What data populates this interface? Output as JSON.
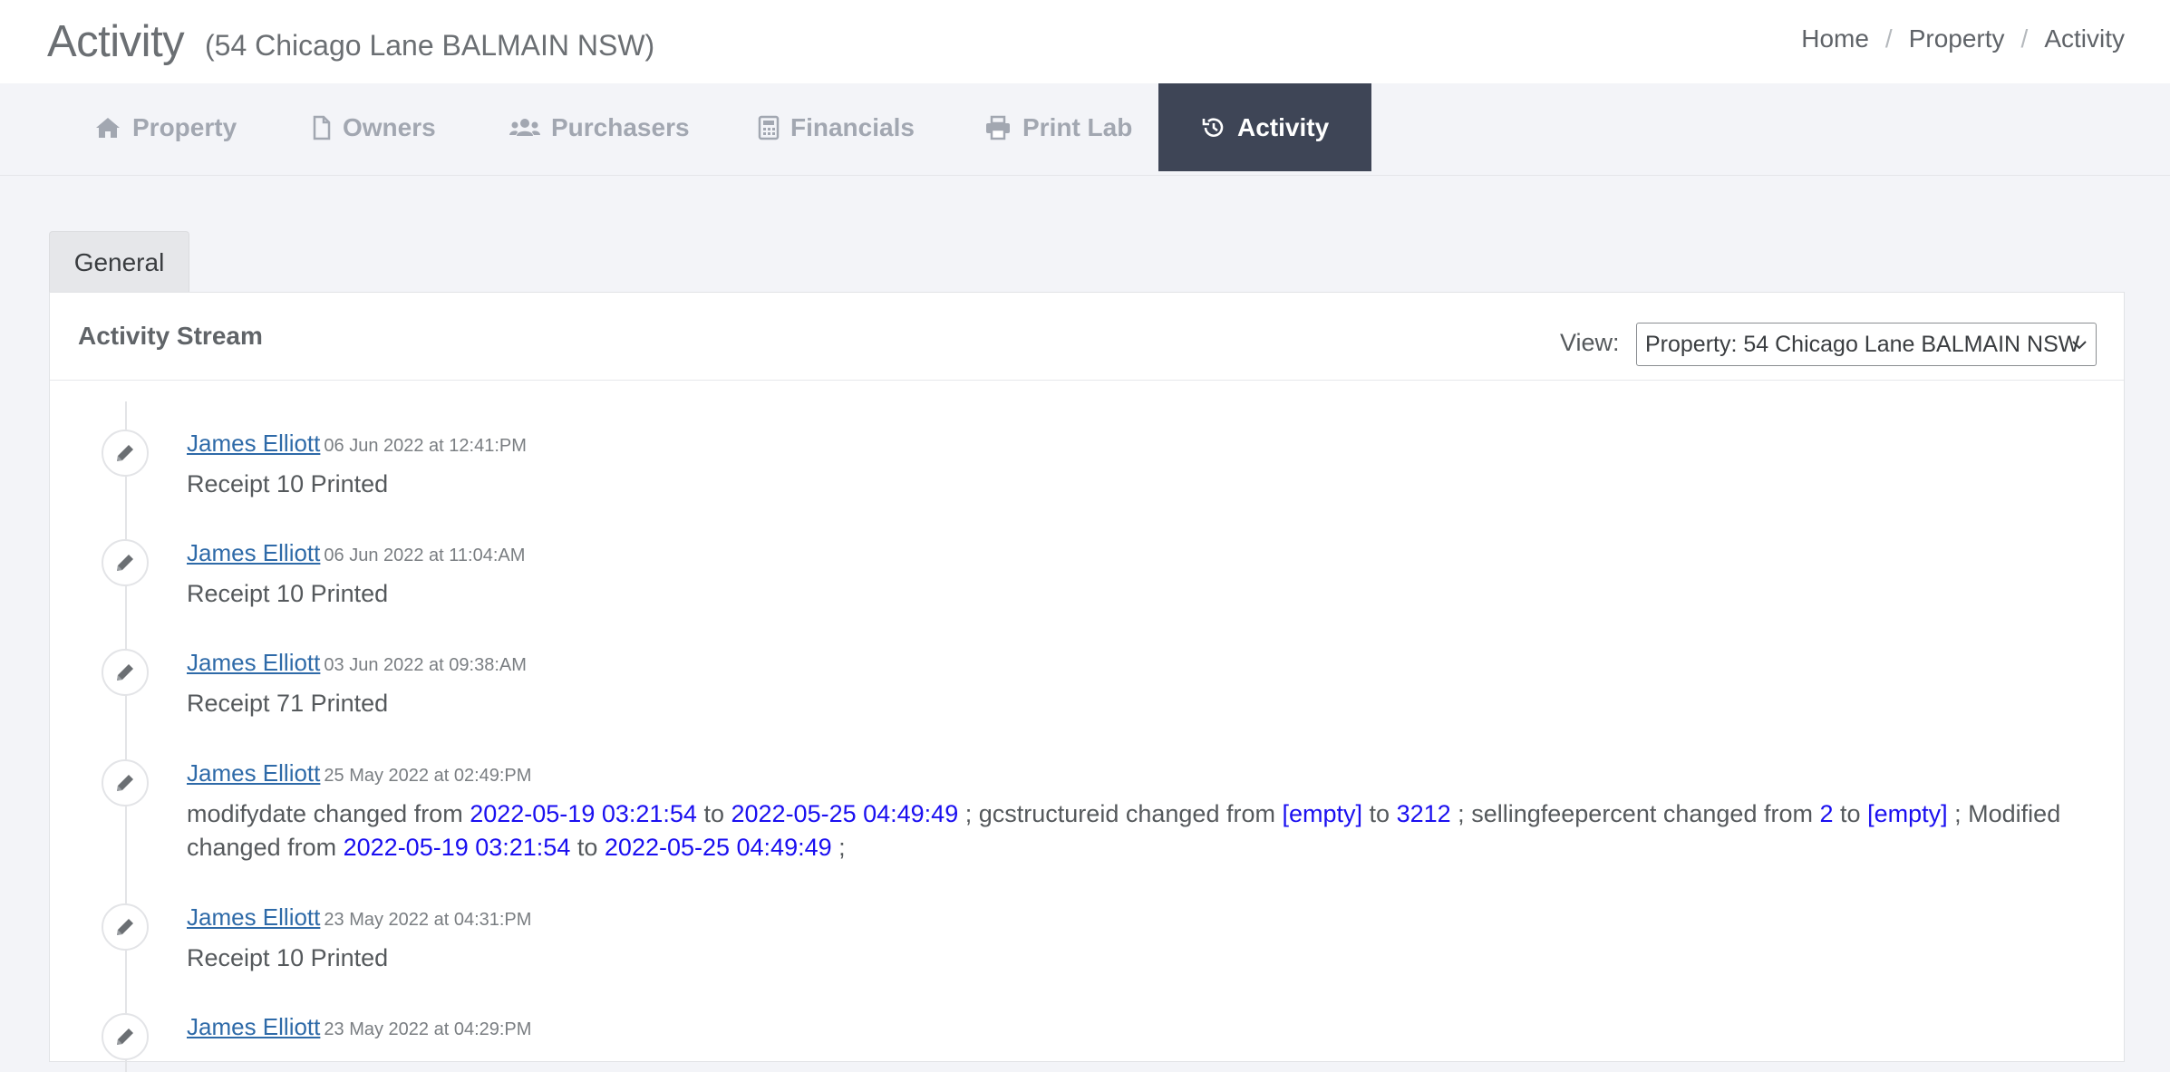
{
  "header": {
    "title": "Activity",
    "subtitle": "(54 Chicago Lane BALMAIN NSW)",
    "breadcrumb": [
      "Home",
      "Property",
      "Activity"
    ]
  },
  "tabs": [
    {
      "label": "Property",
      "icon": "home-icon"
    },
    {
      "label": "Owners",
      "icon": "document-icon"
    },
    {
      "label": "Purchasers",
      "icon": "users-icon"
    },
    {
      "label": "Financials",
      "icon": "calculator-icon"
    },
    {
      "label": "Print Lab",
      "icon": "printer-icon"
    },
    {
      "label": "Activity",
      "icon": "history-icon",
      "active": true
    }
  ],
  "subtab": {
    "label": "General"
  },
  "panel": {
    "title": "Activity Stream",
    "view_label": "View:",
    "view_value": "Property: 54 Chicago Lane BALMAIN NSW"
  },
  "entries": [
    {
      "user": "James Elliott",
      "time": "06 Jun 2022 at 12:41:PM",
      "text": "Receipt 10 Printed"
    },
    {
      "user": "James Elliott",
      "time": "06 Jun 2022 at 11:04:AM",
      "text": "Receipt 10 Printed"
    },
    {
      "user": "James Elliott",
      "time": "03 Jun 2022 at 09:38:AM",
      "text": "Receipt 71 Printed"
    },
    {
      "user": "James Elliott",
      "time": "25 May 2022 at 02:49:PM",
      "changes": [
        {
          "field": "modifydate",
          "from": "2022-05-19 03:21:54",
          "to": "2022-05-25 04:49:49"
        },
        {
          "field": "gcstructureid",
          "from": "[empty]",
          "to": "3212"
        },
        {
          "field": "sellingfeepercent",
          "from": "2",
          "to": "[empty]"
        },
        {
          "field": "Modified",
          "from": "2022-05-19 03:21:54",
          "to": "2022-05-25 04:49:49"
        }
      ],
      "words": {
        "changed_from": "changed from",
        "to": "to",
        "sep": ";"
      }
    },
    {
      "user": "James Elliott",
      "time": "23 May 2022 at 04:31:PM",
      "text": "Receipt 10 Printed"
    },
    {
      "user": "James Elliott",
      "time": "23 May 2022 at 04:29:PM",
      "text": ""
    }
  ],
  "colors": {
    "active_tab_bg": "#3e4556",
    "link": "#2e6aa8",
    "value": "#1a0ff0",
    "tab_text": "#a2a7b1"
  }
}
